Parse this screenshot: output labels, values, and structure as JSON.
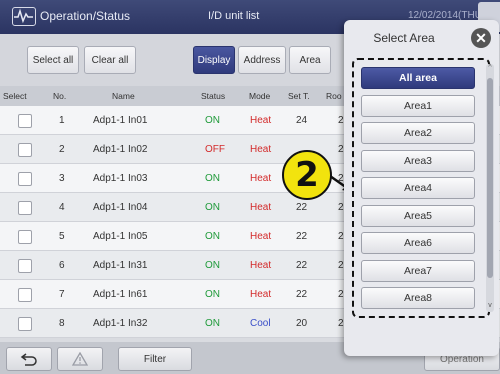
{
  "header": {
    "title": "Operation/Status",
    "center_title": "I/D unit list",
    "right_text": "12/02/2014(THU) 09:41"
  },
  "toolbar": {
    "select_all": "Select all",
    "clear_all": "Clear all",
    "display": "Display",
    "address": "Address",
    "area": "Area"
  },
  "table": {
    "headers": {
      "select": "Select",
      "no": "No.",
      "name": "Name",
      "status": "Status",
      "mode": "Mode",
      "set_t": "Set T.",
      "room": "Roo"
    },
    "rows": [
      {
        "no": "1",
        "name": "Adp1-1 In01",
        "status": "ON",
        "mode": "Heat",
        "set_t": "24",
        "room": "2"
      },
      {
        "no": "2",
        "name": "Adp1-1 In02",
        "status": "OFF",
        "mode": "Heat",
        "set_t": "",
        "room": "2"
      },
      {
        "no": "3",
        "name": "Adp1-1 In03",
        "status": "ON",
        "mode": "Heat",
        "set_t": "",
        "room": "2"
      },
      {
        "no": "4",
        "name": "Adp1-1 In04",
        "status": "ON",
        "mode": "Heat",
        "set_t": "22",
        "room": "2"
      },
      {
        "no": "5",
        "name": "Adp1-1 In05",
        "status": "ON",
        "mode": "Heat",
        "set_t": "22",
        "room": "2"
      },
      {
        "no": "6",
        "name": "Adp1-1 In31",
        "status": "ON",
        "mode": "Heat",
        "set_t": "22",
        "room": "2"
      },
      {
        "no": "7",
        "name": "Adp1-1 In61",
        "status": "ON",
        "mode": "Heat",
        "set_t": "22",
        "room": "2"
      },
      {
        "no": "8",
        "name": "Adp1-1 In32",
        "status": "ON",
        "mode": "Cool",
        "set_t": "20",
        "room": "2"
      }
    ]
  },
  "footer": {
    "filter": "Filter",
    "operation": "Operation"
  },
  "dialog": {
    "title": "Select Area",
    "areas": [
      "All area",
      "Area1",
      "Area2",
      "Area3",
      "Area4",
      "Area5",
      "Area6",
      "Area7",
      "Area8"
    ],
    "selected": "All area"
  },
  "callout": {
    "step": "2"
  },
  "colors": {
    "header_bg": "#2f3866",
    "accent": "#34407f",
    "status_on": "#1f9a3a",
    "status_off": "#d32a2a",
    "mode_heat": "#d32a2a",
    "mode_cool": "#3a4fc9",
    "callout_fill": "#f2e30e"
  }
}
